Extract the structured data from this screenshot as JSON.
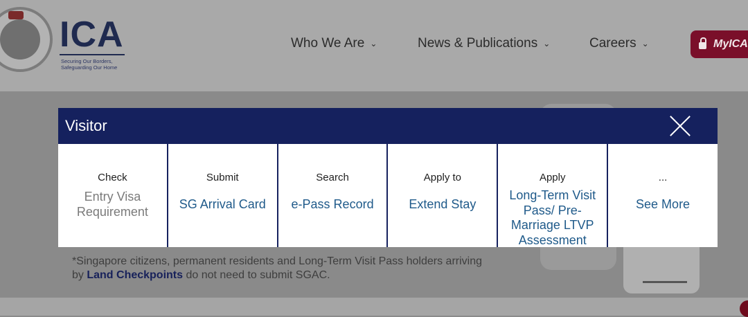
{
  "header": {
    "logo_text": "ICA",
    "tagline_line1": "Securing Our Borders,",
    "tagline_line2": "Safeguarding Our Home",
    "nav": [
      {
        "label": "Who We Are",
        "chevron": "⌄"
      },
      {
        "label": "News & Publications",
        "chevron": "⌄"
      },
      {
        "label": "Careers",
        "chevron": "⌄"
      }
    ],
    "myica_label": "MyICA"
  },
  "modal": {
    "title": "Visitor",
    "close_icon": "close-icon",
    "cards": [
      {
        "verb": "Check",
        "action": "Entry Visa Requirement",
        "style": "grey"
      },
      {
        "verb": "Submit",
        "action": "SG Arrival Card",
        "style": "link"
      },
      {
        "verb": "Search",
        "action": "e-Pass Record",
        "style": "link"
      },
      {
        "verb": "Apply to",
        "action": "Extend Stay",
        "style": "link"
      },
      {
        "verb": "Apply",
        "action": "Long-Term Visit Pass/ Pre-Marriage LTVP Assessment",
        "style": "link"
      },
      {
        "verb": "...",
        "action": "See More",
        "style": "link"
      }
    ]
  },
  "footnote": {
    "prefix": "*Singapore citizens, permanent residents and Long-Term Visit Pass holders arriving by ",
    "bold": "Land Checkpoints",
    "suffix": " do not need to submit SGAC."
  },
  "colors": {
    "modal_header": "#15215e",
    "link": "#1f5a8a",
    "myica_bg": "#7a0f2a"
  }
}
